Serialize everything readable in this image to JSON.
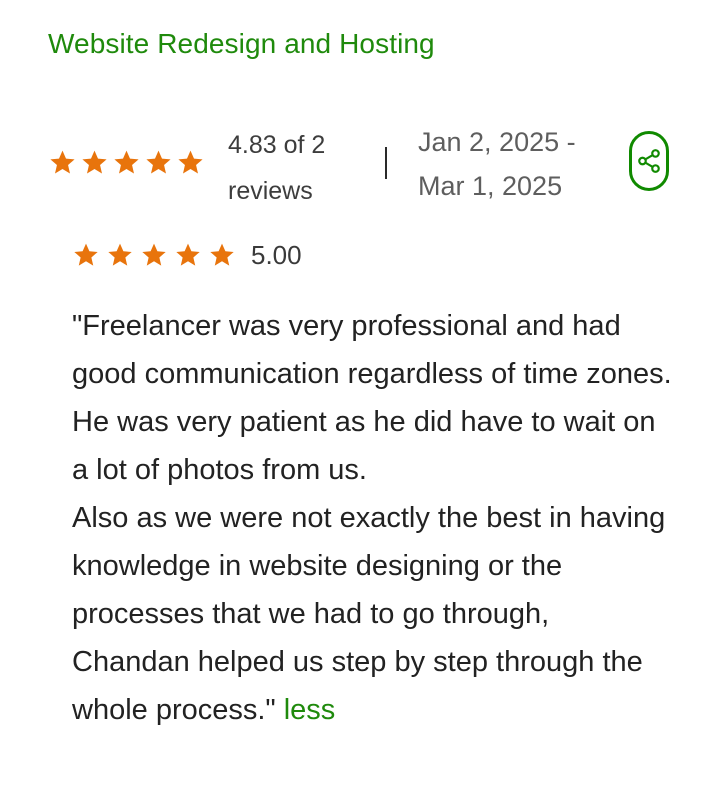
{
  "job": {
    "title": "Website Redesign and Hosting"
  },
  "summary": {
    "rating_text": "4.83 of 2 reviews",
    "overall_stars": 5,
    "date_start": "Jan 2, 2025 -",
    "date_end": "Mar 1, 2025"
  },
  "review": {
    "stars": 5,
    "score": "5.00",
    "paragraph_1": "\"Freelancer was very professional and had good communication regardless of time zones. He was very patient as he did have to wait on a lot of photos from us.",
    "paragraph_2": "Also as we were not exactly the best in having knowledge in website designing or the processes that we had to go through, Chandan helped us step by step through the whole process.\"",
    "less_label": "less"
  },
  "icons": {
    "star": "star-icon",
    "share": "share-icon"
  },
  "colors": {
    "star": "#e8740c",
    "accent_green": "#1f8a0c",
    "text": "#222222"
  }
}
